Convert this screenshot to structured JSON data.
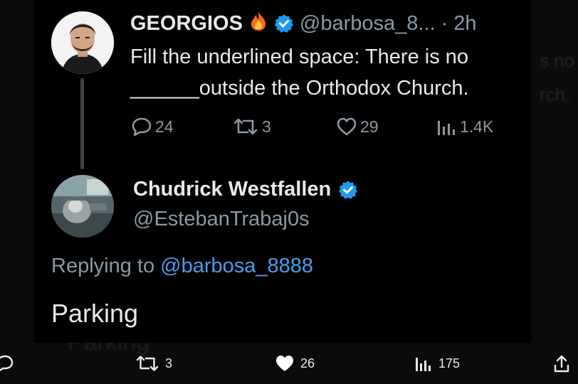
{
  "tweet": {
    "display_name": "GEORGIOS",
    "handle": "@barbosa_8...",
    "time": "· 2h",
    "body_line1": "Fill the underlined space: There is no",
    "body_line2": "______outside the Orthodox Church.",
    "stats": {
      "replies": "24",
      "retweets": "3",
      "likes": "29",
      "views": "1.4K"
    }
  },
  "reply": {
    "display_name": "Chudrick Westfallen",
    "handle": "@EstebanTrabaj0s",
    "replying_prefix": "Replying to",
    "replying_handle": "@barbosa_8888",
    "body": "Parking"
  },
  "bottom_bar": {
    "retweets": "3",
    "likes": "26",
    "views": "175"
  },
  "background_text": {
    "ghost_1": "s no",
    "ghost_2": "rch.",
    "ghost_3": "Parking"
  },
  "colors": {
    "verified": "#1d9bf0",
    "mention": "#4a9eec",
    "muted": "#8b98a5",
    "fire": "#ff6a1f"
  }
}
